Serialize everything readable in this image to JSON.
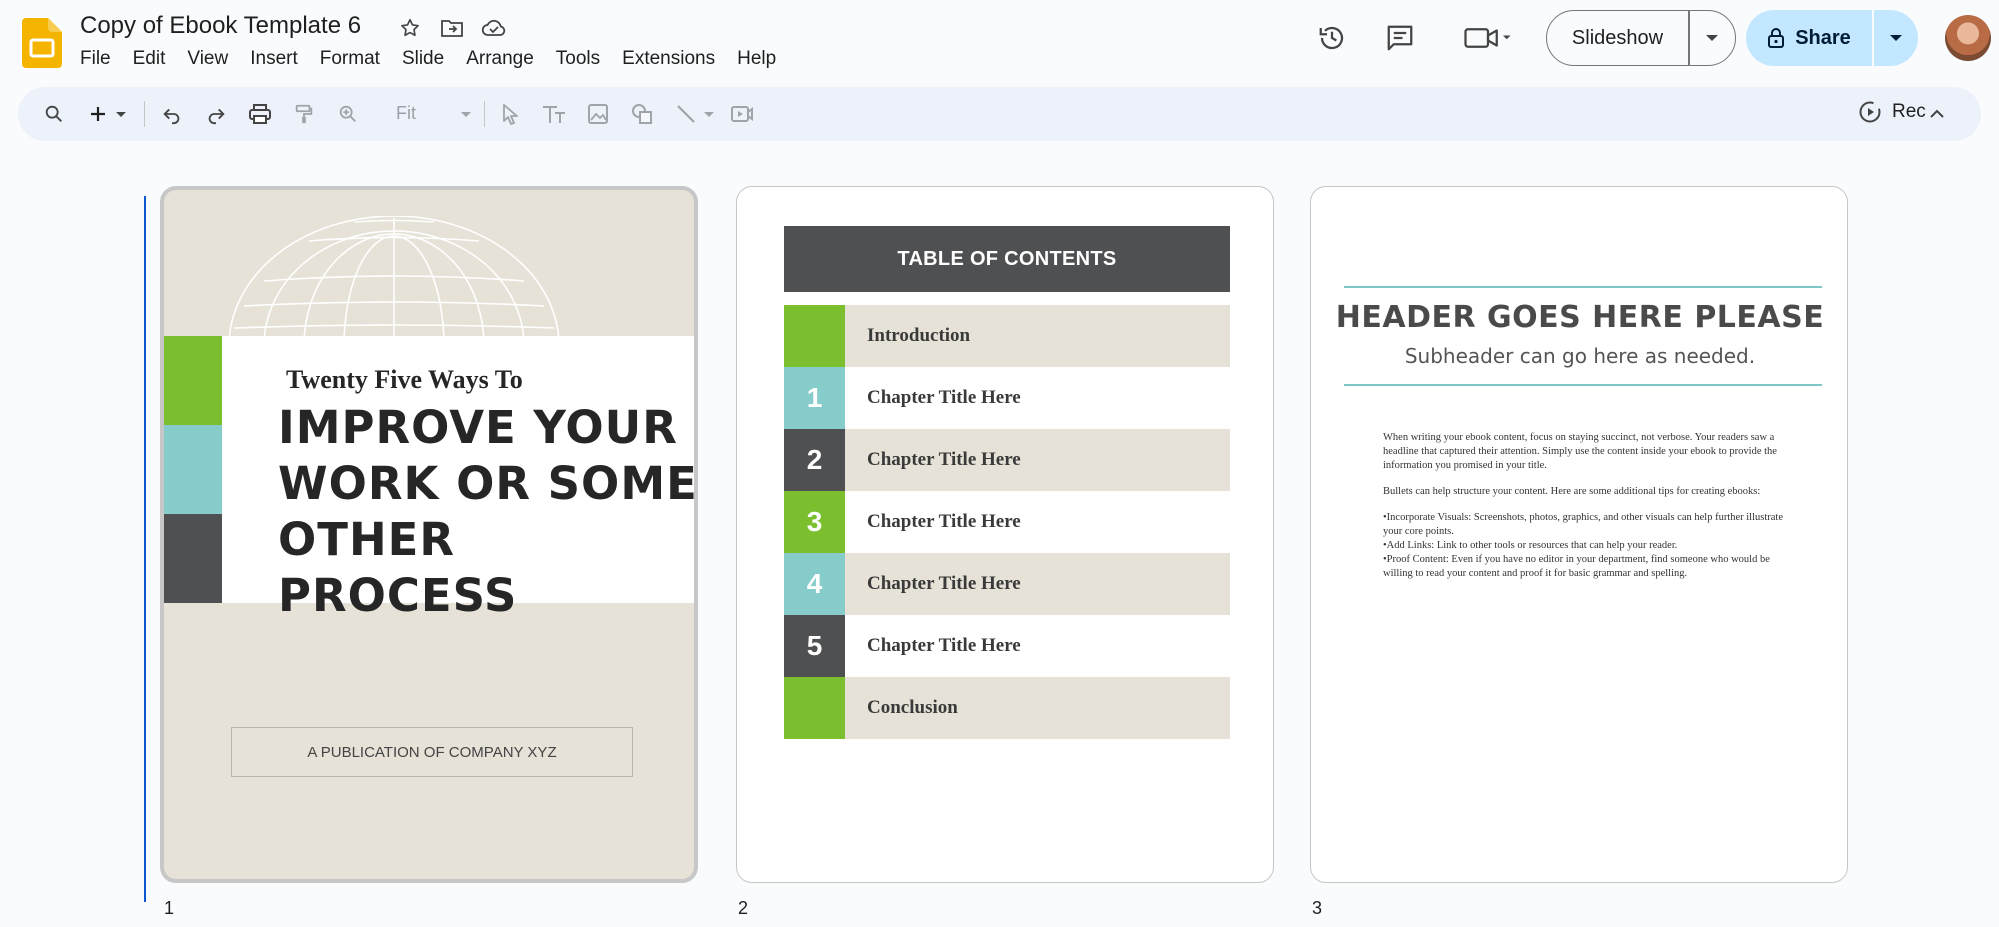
{
  "app": {
    "doc_title": "Copy of Ebook Template 6",
    "brand_color": "#f4b400",
    "title_icons": [
      "star-icon",
      "move-to-folder-icon",
      "cloud-saved-icon"
    ]
  },
  "menu": [
    "File",
    "Edit",
    "View",
    "Insert",
    "Format",
    "Slide",
    "Arrange",
    "Tools",
    "Extensions",
    "Help"
  ],
  "header_actions": {
    "slideshow_label": "Slideshow",
    "share_label": "Share",
    "share_color": "#c2e7ff",
    "icons": [
      "version-history-icon",
      "comments-icon",
      "meet-camera-icon"
    ]
  },
  "toolbar": {
    "zoom_value": "Fit",
    "rec_label": "Rec",
    "icons": [
      "search-icon",
      "new-slide-icon",
      "undo-icon",
      "redo-icon",
      "print-icon",
      "paint-format-icon",
      "zoom-icon",
      "select-icon",
      "text-box-icon",
      "image-icon",
      "shape-icon",
      "line-icon",
      "insert-video-icon"
    ]
  },
  "slides": {
    "numbers": [
      "1",
      "2",
      "3"
    ],
    "slide1": {
      "kicker": "Twenty Five Ways To",
      "headline_lines": [
        "IMPROVE YOUR",
        "WORK OR SOME",
        "OTHER PROCESS"
      ],
      "publication": "A PUBLICATION OF COMPANY XYZ",
      "colors": [
        "#7bbf2f",
        "#86cccb",
        "#4f5052"
      ]
    },
    "slide2": {
      "heading": "TABLE OF CONTENTS",
      "rows": [
        {
          "num": "",
          "label": "Introduction",
          "color": "#7bbf2f",
          "bg": "#e6e2d7"
        },
        {
          "num": "1",
          "label": "Chapter Title Here",
          "color": "#86cccb",
          "bg": "#ffffff"
        },
        {
          "num": "2",
          "label": "Chapter Title Here",
          "color": "#4f5052",
          "bg": "#e6e2d7"
        },
        {
          "num": "3",
          "label": "Chapter Title Here",
          "color": "#7bbf2f",
          "bg": "#ffffff"
        },
        {
          "num": "4",
          "label": "Chapter Title Here",
          "color": "#86cccb",
          "bg": "#e6e2d7"
        },
        {
          "num": "5",
          "label": "Chapter Title Here",
          "color": "#4f5052",
          "bg": "#ffffff"
        },
        {
          "num": "",
          "label": "Conclusion",
          "color": "#7bbf2f",
          "bg": "#e6e2d7"
        }
      ]
    },
    "slide3": {
      "header": "HEADER GOES HERE PLEASE",
      "subheader": "Subheader can go here as needed.",
      "paragraph1": "When writing your ebook content, focus on staying succinct, not verbose. Your readers saw a headline that captured their attention. Simply use the content inside your ebook to provide the information you promised in your title.",
      "paragraph2": "Bullets can help structure your content. Here are some additional tips for creating ebooks:",
      "bullets": [
        "•Incorporate Visuals: Screenshots, photos, graphics, and other visuals can help further illustrate your core points.",
        "•Add Links: Link to other tools or resources that can help your reader.",
        "•Proof Content: Even if you have no editor in your department, find someone who would be willing to read your content and proof it for basic grammar and spelling."
      ]
    }
  }
}
